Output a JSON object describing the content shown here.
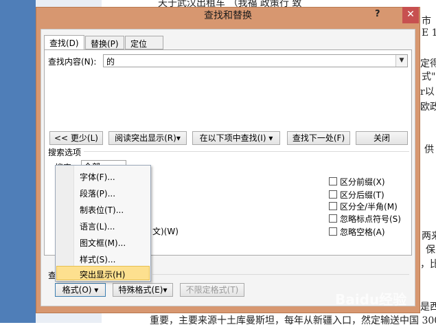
{
  "dialog": {
    "title": "查找和替换",
    "help_label": "?",
    "close_label": "✕",
    "tabs": [
      {
        "label": "查找(D)",
        "active": true
      },
      {
        "label": "替换(P)",
        "active": false
      },
      {
        "label": "定位(G)",
        "active": false
      }
    ],
    "find_label": "查找内容(N):",
    "find_value": "的",
    "buttons": {
      "less": "<< 更少(L)",
      "reading_highlight": "阅读突出显示(R)▾",
      "find_in": "在以下项中查找(I) ▾",
      "find_next": "查找下一处(F)",
      "close": "关闭"
    },
    "search_options_label": "搜索选项",
    "search_label_partial": "搜索:",
    "search_select_value": "全部",
    "checkboxes_right": [
      {
        "label": "区分前缀(X)",
        "checked": false
      },
      {
        "label": "区分后缀(T)",
        "checked": false
      },
      {
        "label": "区分全/半角(M)",
        "checked": false
      },
      {
        "label": "忽略标点符号(S)",
        "checked": false
      },
      {
        "label": "忽略空格(A)",
        "checked": false
      }
    ],
    "partial_left_text": "文)(W)",
    "find_section_partial": "查",
    "bottom_buttons": {
      "format": "格式(O) ▾",
      "special": "特殊格式(E)▾",
      "no_format": "不限定格式(T)"
    }
  },
  "format_menu": {
    "items": [
      "字体(F)...",
      "段落(P)...",
      "制表位(T)...",
      "语言(L)...",
      "图文框(M)...",
      "样式(S)...",
      "突出显示(H)"
    ],
    "highlighted_index": 6
  },
  "background_doc": {
    "top_text": "天于武汉出租车 （我福  政策行 致",
    "right_fragments": [
      "市",
      "E 1",
      "定得",
      "式\"",
      "r以",
      "欧政",
      "供",
      "两来",
      "保",
      "，比",
      "是西"
    ],
    "bottom_text": "重要，主要来源十土库曼斯坦，每年从新疆入口，然定输送中国 300"
  },
  "watermark": "Baidu经验"
}
